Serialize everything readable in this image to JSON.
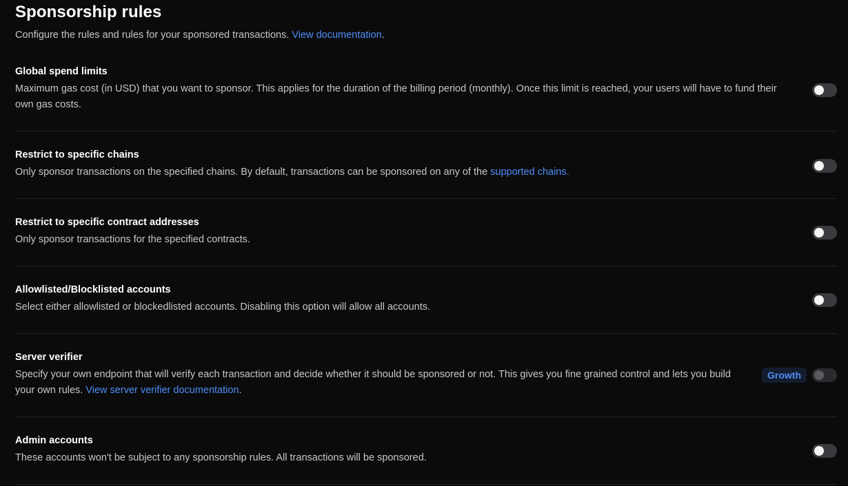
{
  "header": {
    "title": "Sponsorship rules",
    "subtitle": "Configure the rules and rules for your sponsored transactions.",
    "doc_link": "View documentation",
    "subtitle_end": "."
  },
  "rules": [
    {
      "title": "Global spend limits",
      "description": "Maximum gas cost (in USD) that you want to sponsor. This applies for the duration of the billing period (monthly). Once this limit is reached, your users will have to fund their own gas costs.",
      "enabled": false
    },
    {
      "title": "Restrict to specific chains",
      "description": "Only sponsor transactions on the specified chains. By default, transactions can be sponsored on any of the",
      "link": "supported chains.",
      "enabled": false
    },
    {
      "title": "Restrict to specific contract addresses",
      "description": "Only sponsor transactions for the specified contracts.",
      "enabled": false
    },
    {
      "title": "Allowlisted/Blocklisted accounts",
      "description": "Select either allowlisted or blockedlisted accounts. Disabling this option will allow all accounts.",
      "enabled": false
    },
    {
      "title": "Server verifier",
      "description": "Specify your own endpoint that will verify each transaction and decide whether it should be sponsored or not. This gives you fine grained control and lets you build your own rules.",
      "link": "View server verifier documentation",
      "description_end": ".",
      "badge": "Growth",
      "enabled": false,
      "locked": true
    },
    {
      "title": "Admin accounts",
      "description": "These accounts won't be subject to any sponsorship rules. All transactions will be sponsored.",
      "enabled": false
    }
  ],
  "colors": {
    "background": "#0b0b0c",
    "link": "#4f8ef7",
    "divider": "#222225",
    "toggle_off": "#3a3a3f"
  }
}
